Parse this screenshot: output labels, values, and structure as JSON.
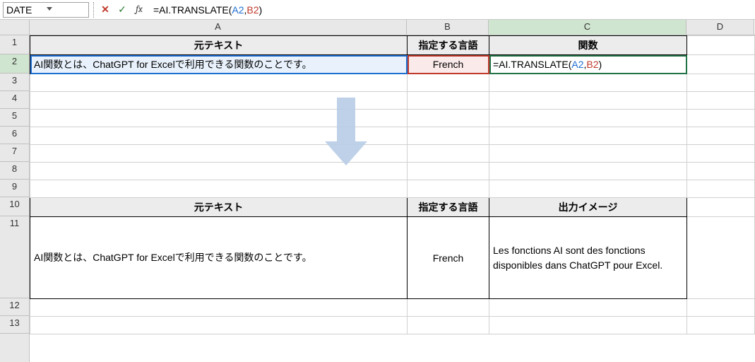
{
  "formula_bar": {
    "name_box": "DATE",
    "formula_prefix": "=AI.TRANSLATE(",
    "formula_ref1": "A2",
    "formula_comma": ",",
    "formula_ref2": "B2",
    "formula_suffix": ")"
  },
  "columns": [
    "A",
    "B",
    "C",
    "D"
  ],
  "rows": [
    "1",
    "2",
    "3",
    "4",
    "5",
    "6",
    "7",
    "8",
    "9",
    "10",
    "11",
    "12",
    "13"
  ],
  "table1": {
    "headers": {
      "A": "元テキスト",
      "B": "指定する言語",
      "C": "関数"
    },
    "row2": {
      "A": "AI関数とは、ChatGPT for Excelで利用できる関数のことです。",
      "B": "French",
      "C_prefix": "=AI.TRANSLATE(",
      "C_ref1": "A2",
      "C_comma": ",",
      "C_ref2": "B2",
      "C_suffix": ")"
    }
  },
  "table2": {
    "headers": {
      "A": "元テキスト",
      "B": "指定する言語",
      "C": "出力イメージ"
    },
    "row11": {
      "A": "AI関数とは、ChatGPT for Excelで利用できる関数のことです。",
      "B": "French",
      "C": "Les fonctions AI sont des fonctions disponibles dans ChatGPT pour Excel."
    }
  },
  "icons": {
    "cancel": "✕",
    "confirm": "✓",
    "fx": "fx"
  },
  "colors": {
    "ref_blue": "#1f6fd1",
    "ref_red": "#c0392b",
    "excel_green": "#217346"
  }
}
